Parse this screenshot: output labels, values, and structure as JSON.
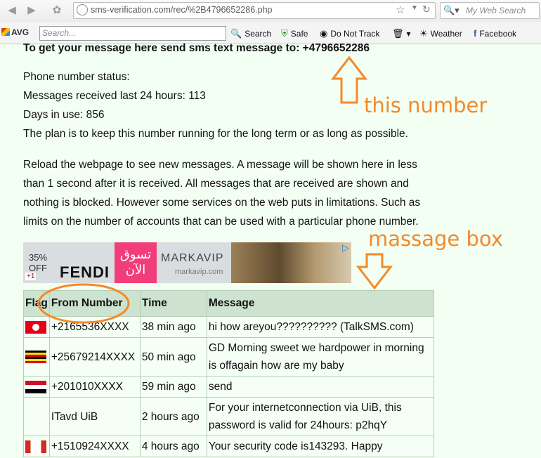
{
  "browser": {
    "url": "sms-verification.com/rec/%2B4796652286.php",
    "search_placeholder": "My Web Search"
  },
  "toolbar": {
    "brand": "AVG",
    "search_placeholder": "Search...",
    "search_label": "Search",
    "safe_label": "Safe",
    "dnt_label": "Do Not Track",
    "weather_label": "Weather",
    "facebook_label": "Facebook"
  },
  "page": {
    "headline": "To get your message here send sms text message to: +4796652286",
    "status_title": "Phone number status:",
    "received_24h": "Messages received last 24 hours: 113",
    "days_in_use": "Days in use: 856",
    "plan": "The plan is to keep this number running for the long term or as long as possible.",
    "reload_lines": [
      "Reload the webpage to see new messages. A message will be shown here in less",
      "than 1 second after it is received. All messages that are received are shown and",
      "nothing is blocked. However some services on the web puts in limitations. Such as",
      "limits on the number of accounts that can be used with a particular phone number."
    ]
  },
  "ad": {
    "percent": "35%",
    "off": "OFF",
    "brand": "FENDI",
    "arabic_line1": "تسوق",
    "arabic_line2": "الآن",
    "site": "MARKAVIP",
    "site_url": "markavip.com",
    "plus_one": "+1"
  },
  "table": {
    "headers": [
      "Flag",
      "From Number",
      "Time",
      "Message"
    ],
    "rows": [
      {
        "flag": "tn",
        "from": "+2165536XXXX",
        "time": "38 min ago",
        "message": [
          "hi how areyou?????????? (TalkSMS.com)"
        ]
      },
      {
        "flag": "ug",
        "from": "+25679214XXXX",
        "time": "50 min ago",
        "message": [
          "GD Morning sweet we hardpower in morning",
          "is offagain how are my baby"
        ]
      },
      {
        "flag": "eg",
        "from": "+201010XXXX",
        "time": "59 min ago",
        "message": [
          "send"
        ]
      },
      {
        "flag": "",
        "from": "ITavd UiB",
        "time": "2 hours ago",
        "message": [
          "For your internetconnection via UiB, this",
          "password is valid for 24hours: p2hqY"
        ]
      },
      {
        "flag": "ca",
        "from": "+1510924XXXX",
        "time": "4 hours ago",
        "message": [
          "Your security code is143293. Happy"
        ]
      }
    ]
  },
  "annotations": {
    "this_number": "this number",
    "message_box": "massage box"
  },
  "colors": {
    "annotation": "#f38a2a",
    "page_bg": "#f2fff2",
    "table_header_bg": "#cde2cf"
  }
}
